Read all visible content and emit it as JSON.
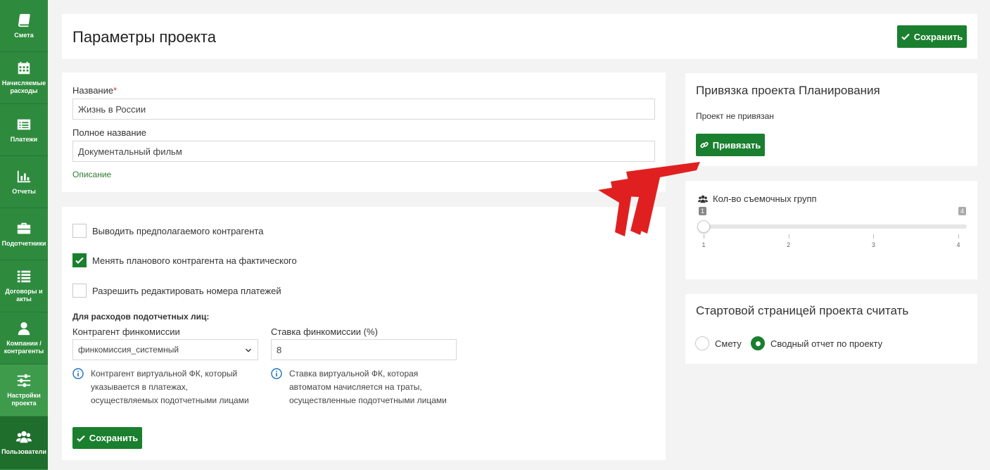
{
  "sidebar": {
    "items": [
      {
        "label": "Смета",
        "icon": "book-icon"
      },
      {
        "label": "Начисляемые расходы",
        "icon": "calendar-icon"
      },
      {
        "label": "Платежи",
        "icon": "list-alt-icon"
      },
      {
        "label": "Отчеты",
        "icon": "bar-chart-icon"
      },
      {
        "label": "Подотчетники",
        "icon": "briefcase-icon"
      },
      {
        "label": "Договоры и акты",
        "icon": "list-icon"
      },
      {
        "label": "Компании / контрагенты",
        "icon": "user-icon"
      },
      {
        "label": "Настройки проекта",
        "icon": "sliders-icon"
      },
      {
        "label": "Пользователи",
        "icon": "users-icon"
      }
    ]
  },
  "header": {
    "title": "Параметры проекта",
    "save_label": "Сохранить"
  },
  "form": {
    "name_label": "Название",
    "name_required": "*",
    "name_value": "Жизнь в России",
    "fullname_label": "Полное название",
    "fullname_value": "Документальный фильм",
    "description_link": "Описание"
  },
  "options": {
    "checkboxes": [
      {
        "label": "Выводить предполагаемого контрагента",
        "checked": false
      },
      {
        "label": "Менять планового контрагента на фактического",
        "checked": true
      },
      {
        "label": "Разрешить редактировать номера платежей",
        "checked": false
      }
    ],
    "section_title": "Для расходов подотчетных лиц:",
    "counterparty_label": "Контрагент финкомиссии",
    "counterparty_value": "финкомиссия_системный",
    "rate_label": "Ставка финкомиссии (%)",
    "rate_value": "8",
    "counterparty_help": [
      "Контрагент виртуальной ФК, который",
      "указывается в платежах,",
      "осуществляемых подотчетными лицами"
    ],
    "rate_help": [
      "Ставка виртуальной ФК, которая",
      "автоматом начисляется на траты,",
      "осуществленные подотчетными лицами"
    ],
    "save_label": "Сохранить"
  },
  "planning": {
    "title": "Привязка проекта Планирования",
    "status": "Проект не привязан",
    "bind_label": "Привязать"
  },
  "crews": {
    "label": "Кол-во съемочных групп",
    "min_label": "1",
    "max_label": "4",
    "value": 1,
    "min": 1,
    "max": 4,
    "ticks": [
      "1",
      "2",
      "3",
      "4"
    ]
  },
  "start_page": {
    "title": "Стартовой страницей проекта считать",
    "options": [
      {
        "label": "Смету",
        "checked": false
      },
      {
        "label": "Сводный отчет по проекту",
        "checked": true
      }
    ]
  },
  "colors": {
    "accent": "#1a7f2e",
    "sidebar": "#2e8b3e",
    "arrow": "#e02020"
  }
}
